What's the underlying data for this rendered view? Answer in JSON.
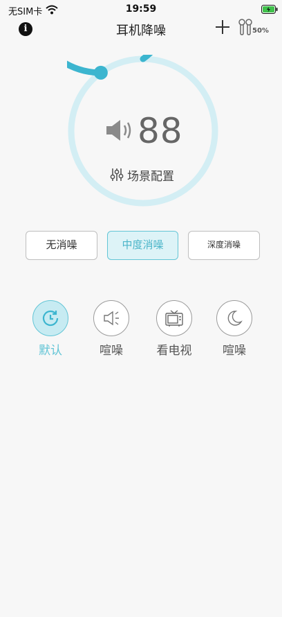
{
  "status_bar": {
    "carrier": "无SIM卡",
    "time": "19:59"
  },
  "nav": {
    "title": "耳机降噪",
    "battery_percent": "50%"
  },
  "volume": {
    "value": "88",
    "dial_level": 0.9
  },
  "scene_config": {
    "label": "场景配置"
  },
  "modes": [
    {
      "label": "无消噪",
      "selected": false
    },
    {
      "label": "中度消噪",
      "selected": true
    },
    {
      "label": "深度消噪",
      "selected": false
    }
  ],
  "scenes": [
    {
      "label": "默认",
      "icon": "clock-icon",
      "selected": true
    },
    {
      "label": "喧噪",
      "icon": "speaker-low-icon",
      "selected": false
    },
    {
      "label": "看电视",
      "icon": "tv-icon",
      "selected": false
    },
    {
      "label": "喧噪",
      "icon": "moon-icon",
      "selected": false
    }
  ],
  "colors": {
    "accent": "#3cb5cf",
    "accent_light": "#c7ebf2",
    "track": "#d3eef4"
  }
}
